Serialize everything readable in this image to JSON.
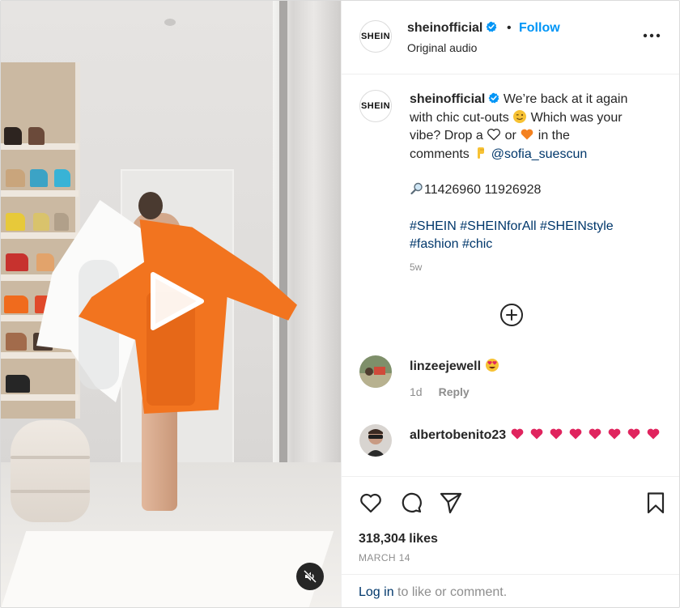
{
  "post": {
    "author": {
      "username": "sheinofficial",
      "avatar_text": "SHEIN",
      "verified": true
    },
    "header": {
      "separator": "•",
      "follow_label": "Follow",
      "audio_label": "Original audio",
      "more_icon": "more-horizontal-icon"
    },
    "media": {
      "type": "video",
      "play_icon": "play-icon",
      "mute_icon": "muted-speaker-icon"
    },
    "caption": {
      "line1_a": "We’re back at it again",
      "line2_a": "with chic cut-outs",
      "line2_b": "Which was your",
      "line3_a": "vibe? Drop a",
      "line3_b": "or",
      "line3_c": "in the",
      "line4_a": "comments",
      "mention": "@sofia_suescun",
      "codes_line": "11426960 11926928",
      "hashtags_line1": [
        "#SHEIN",
        "#SHEINforAll",
        "#SHEINstyle"
      ],
      "hashtags_line2": [
        "#fashion",
        "#chic"
      ],
      "emoji": {
        "wink": "winking-face-icon",
        "white_heart": "white-heart-icon",
        "orange_heart": "orange-heart-icon",
        "point_down": "backhand-index-pointing-down-icon",
        "magnifier": "magnifying-glass-icon"
      },
      "time_ago": "5w"
    },
    "load_more_icon": "plus-circle-icon",
    "comments": [
      {
        "username": "linzeejewell",
        "emoji": "heart-eyes-icon",
        "time": "1d",
        "reply_label": "Reply"
      },
      {
        "username": "albertobenito23",
        "emoji": "red-heart-icon",
        "heart_count": 8
      }
    ],
    "actions": {
      "like_icon": "heart-outline-icon",
      "comment_icon": "comment-icon",
      "share_icon": "paper-plane-icon",
      "save_icon": "bookmark-icon"
    },
    "likes_label": "318,304 likes",
    "date_label": "MARCH 14",
    "login_prompt": {
      "link": "Log in",
      "rest": " to like or comment."
    },
    "colors": {
      "accent_blue": "#0095f6",
      "link_dark_blue": "#00376b",
      "secondary_text": "#8e8e8e",
      "verified_blue": "#0095f6",
      "jacket_orange": "#f2741f"
    }
  }
}
